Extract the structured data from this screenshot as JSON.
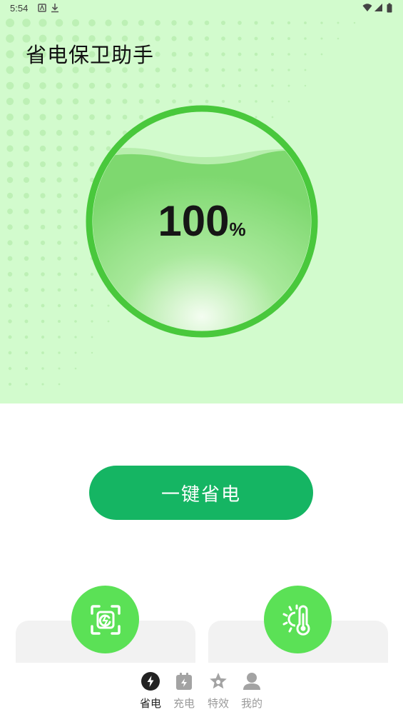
{
  "status_bar": {
    "time": "5:54"
  },
  "header": {
    "title": "省电保卫助手"
  },
  "battery": {
    "level_number": "100",
    "unit": "%",
    "level_fraction": 1.0
  },
  "actions": {
    "one_key_save": "一键省电"
  },
  "cards": [
    {
      "icon": "battery-cleanup-icon"
    },
    {
      "icon": "temperature-icon"
    }
  ],
  "bottom_nav": {
    "items": [
      {
        "label": "省电",
        "icon": "bolt-icon",
        "active": true
      },
      {
        "label": "充电",
        "icon": "charging-icon",
        "active": false
      },
      {
        "label": "特效",
        "icon": "star-icon",
        "active": false
      },
      {
        "label": "我的",
        "icon": "user-icon",
        "active": false
      }
    ]
  },
  "colors": {
    "accent": "#15b563",
    "hero_bg": "#d2fbcd",
    "ring": "#49c83c",
    "card_icon": "#5be156",
    "nav_active": "#222222",
    "nav_inactive": "#9a9a9a"
  }
}
